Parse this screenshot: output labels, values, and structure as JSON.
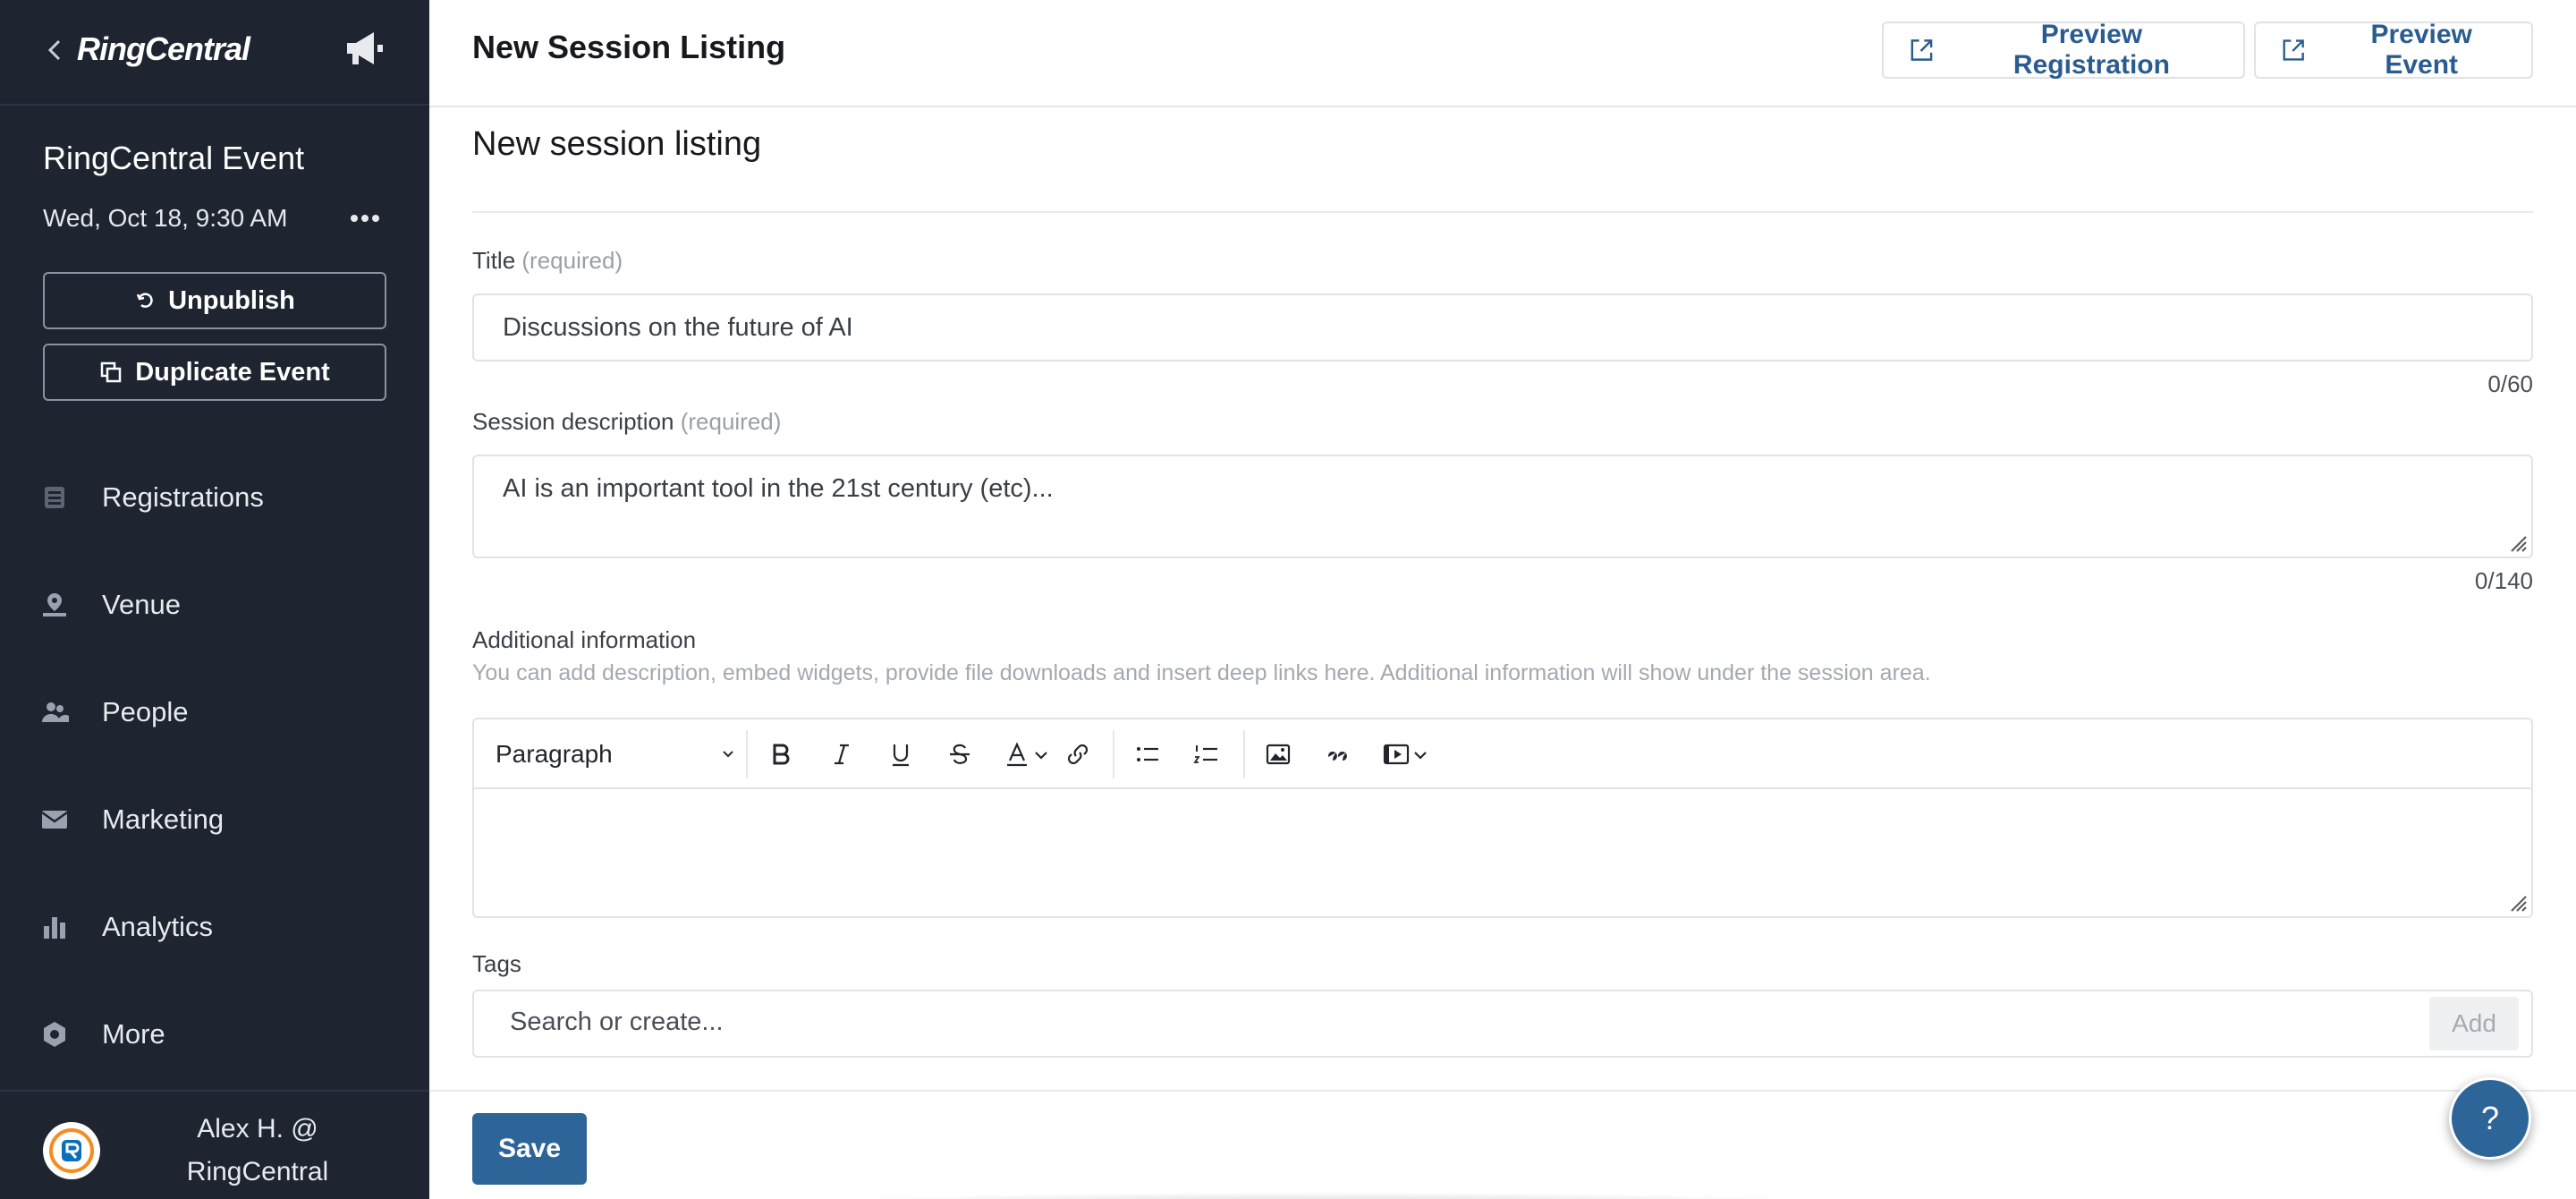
{
  "sidebar": {
    "brand": "RingCentral",
    "event_name": "RingCentral Event",
    "event_date": "Wed, Oct 18, 9:30 AM",
    "unpublish_label": "Unpublish",
    "duplicate_label": "Duplicate Event",
    "nav": [
      {
        "label": "Registrations",
        "icon": "registrations-icon"
      },
      {
        "label": "Venue",
        "icon": "venue-icon"
      },
      {
        "label": "People",
        "icon": "people-icon"
      },
      {
        "label": "Marketing",
        "icon": "mail-icon"
      },
      {
        "label": "Analytics",
        "icon": "bar-chart-icon"
      },
      {
        "label": "More",
        "icon": "hexagon-icon"
      }
    ],
    "user_line1": "Alex H. @",
    "user_line2": "RingCentral"
  },
  "header": {
    "title": "New Session Listing",
    "preview_registration": "Preview Registration",
    "preview_event": "Preview Event"
  },
  "form": {
    "section_title": "New session listing",
    "title_label": "Title",
    "required_text": "(required)",
    "title_value": "Discussions on the future of AI",
    "title_counter": "0/60",
    "description_label": "Session description",
    "description_value": "AI is an important tool in the 21st century (etc)...",
    "description_counter": "0/140",
    "additional_label": "Additional information",
    "additional_hint": "You can add description, embed widgets, provide file downloads and insert deep links here. Additional information will show under the session area.",
    "paragraph_select": "Paragraph",
    "tags_label": "Tags",
    "tags_placeholder": "Search or create...",
    "add_label": "Add"
  },
  "footer": {
    "save_label": "Save",
    "help_label": "?"
  },
  "colors": {
    "sidebar_bg": "#1e2430",
    "accent": "#2e6598",
    "link": "#2b5c8f"
  }
}
